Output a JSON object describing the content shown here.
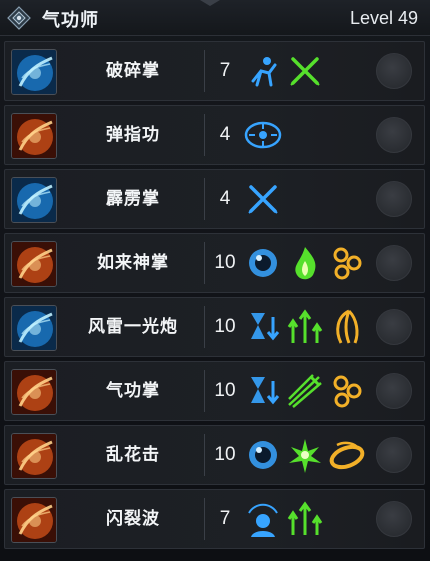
{
  "header": {
    "class_name": "气功师",
    "level_text": "Level 49",
    "emblem_icon": "class-emblem-icon"
  },
  "skills": [
    {
      "name": "破碎掌",
      "count": "7",
      "icon": "shatter-palm-icon",
      "tone": "blue",
      "mods": [
        "sprint-icon",
        "crossed-swords-green-icon"
      ]
    },
    {
      "name": "弹指功",
      "count": "4",
      "icon": "finger-flick-icon",
      "tone": "orange",
      "mods": [
        "target-arrows-icon"
      ]
    },
    {
      "name": "霹雳掌",
      "count": "4",
      "icon": "thunder-palm-icon",
      "tone": "blue",
      "mods": [
        "crossed-swords-blue-icon"
      ]
    },
    {
      "name": "如来神掌",
      "count": "10",
      "icon": "buddha-palm-icon",
      "tone": "orange",
      "mods": [
        "blue-orb-icon",
        "green-flame-icon",
        "gold-swirl-icon"
      ]
    },
    {
      "name": "风雷一光炮",
      "count": "10",
      "icon": "wind-thunder-cannon-icon",
      "tone": "blue",
      "mods": [
        "hourglass-down-icon",
        "green-arrows-up-icon",
        "gold-wings-icon"
      ]
    },
    {
      "name": "气功掌",
      "count": "10",
      "icon": "qigong-palm-icon",
      "tone": "orange",
      "mods": [
        "hourglass-down-icon",
        "green-slash-icon",
        "gold-swirl-icon"
      ]
    },
    {
      "name": "乱花击",
      "count": "10",
      "icon": "chaos-flower-strike-icon",
      "tone": "orange",
      "mods": [
        "blue-orb-icon",
        "green-burst-icon",
        "gold-ring-icon"
      ]
    },
    {
      "name": "闪裂波",
      "count": "7",
      "icon": "flash-rift-wave-icon",
      "tone": "orange",
      "mods": [
        "blue-head-aura-icon",
        "green-arrows-up-icon"
      ]
    }
  ],
  "colors": {
    "panel": "#1b1e23",
    "border": "#2d3138",
    "text": "#f3f5f7",
    "blue_mod": "#37a4ff",
    "green_mod": "#56e02c",
    "gold_mod": "#f2b028"
  }
}
